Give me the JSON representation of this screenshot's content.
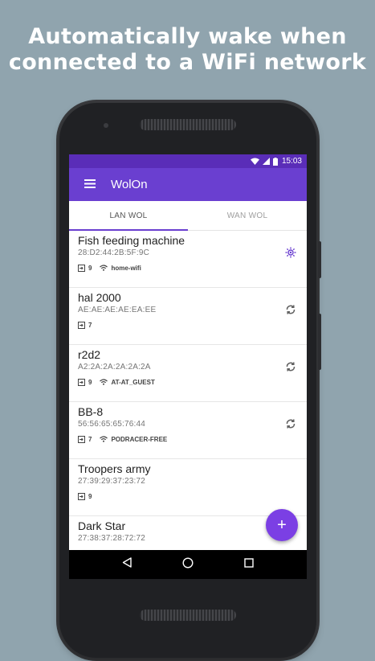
{
  "headline": {
    "line1": "Automatically wake when",
    "line2": "connected to a WiFi network"
  },
  "status_bar": {
    "time": "15:03",
    "icons": [
      "wifi-icon",
      "signal-icon",
      "battery-icon"
    ]
  },
  "app_bar": {
    "title": "WolOn",
    "menu_icon": "menu-icon"
  },
  "tabs": [
    {
      "label": "LAN WOL",
      "active": true
    },
    {
      "label": "WAN WOL",
      "active": false
    }
  ],
  "devices": [
    {
      "name": "Fish feeding machine",
      "mac": "28:D2:44:2B:5F:9C",
      "port": "9",
      "wifi": "home-wifi",
      "action_icon": "brightness-icon"
    },
    {
      "name": "hal 2000",
      "mac": "AE:AE:AE:AE:EA:EE",
      "port": "7",
      "wifi": "",
      "action_icon": "sync-icon"
    },
    {
      "name": "r2d2",
      "mac": "A2:2A:2A:2A:2A:2A",
      "port": "9",
      "wifi": "AT-AT_GUEST",
      "action_icon": "sync-icon"
    },
    {
      "name": "BB-8",
      "mac": "56:56:65:65:76:44",
      "port": "7",
      "wifi": "PODRACER-FREE",
      "action_icon": "sync-icon"
    },
    {
      "name": "Troopers army",
      "mac": "27:39:29:37:23:72",
      "port": "9",
      "wifi": "",
      "action_icon": ""
    },
    {
      "name": "Dark Star",
      "mac": "27:38:37:28:72:72",
      "port": "",
      "wifi": "",
      "action_icon": ""
    }
  ],
  "fab": {
    "label": "+"
  },
  "nav_bar": {
    "icons": [
      "back-icon",
      "home-icon",
      "recents-icon"
    ]
  },
  "colors": {
    "background": "#90a4ae",
    "status_bar": "#5a2db8",
    "app_bar": "#6a3fd0",
    "accent": "#7b3fe4",
    "active_icon": "#6a3fd0"
  }
}
